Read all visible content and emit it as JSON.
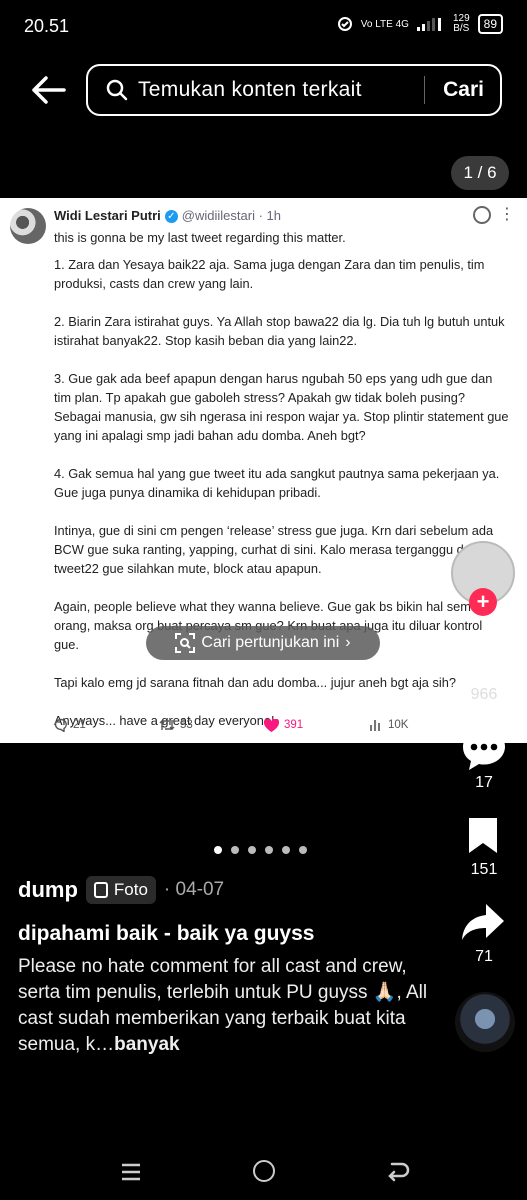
{
  "status_bar": {
    "time": "20.51",
    "network_label": "Vo LTE 4G",
    "speed_value": "129",
    "speed_unit": "B/S",
    "battery": "89"
  },
  "search": {
    "placeholder": "Temukan konten terkait",
    "button_label": "Cari"
  },
  "image_counter": "1 / 6",
  "tweet": {
    "name": "Widi Lestari Putri",
    "handle": "@widiilestari · 1h",
    "paragraphs": [
      "this is gonna be my last tweet regarding this matter.",
      "1. Zara dan Yesaya baik22 aja. Sama juga dengan Zara dan tim penulis, tim produksi, casts dan crew yang lain.",
      "2. Biarin Zara istirahat guys. Ya Allah stop bawa22 dia lg. Dia tuh lg butuh untuk istirahat banyak22. Stop kasih beban dia yang lain22.",
      "3. Gue gak ada beef apapun dengan harus ngubah 50 eps yang udh gue dan tim plan. Tp apakah gue gaboleh stress?  Apakah gw tidak boleh pusing? Sebagai manusia, gw sih ngerasa ini respon wajar ya. Stop plintir statement gue yang ini apalagi smp jadi bahan adu domba. Aneh bgt?",
      "4. Gak semua hal yang gue tweet itu ada sangkut pautnya sama pekerjaan ya. Gue juga punya dinamika di kehidupan pribadi.",
      "Intinya, gue di sini cm pengen ‘release’ stress gue juga. Krn dari sebelum ada BCW gue suka ranting, yapping, curhat di sini.  Kalo merasa terganggu dengan tweet22 gue silahkan mute, block atau apapun.",
      "Again, people believe what they wanna believe. Gue gak bs bikin hal semua orang, maksa org buat percaya sm gue? Krn buat apa juga itu diluar kontrol gue.",
      "Tapi kalo emg jd sarana fitnah dan adu domba... jujur aneh bgt aja sih?",
      "Anyways... have a great day everyone!"
    ],
    "replies": "21",
    "retweets": "53",
    "likes": "391",
    "views": "10K"
  },
  "find_show_pill": "Cari pertunjukan ini",
  "actions": {
    "like_count": "966",
    "comment_count": "17",
    "bookmark_count": "151",
    "share_count": "71"
  },
  "post": {
    "author": "dump",
    "type_tag": "Foto",
    "date": "· 04-07",
    "title": "dipahami baik - baik ya guyss",
    "description": "Please no hate comment for all cast and crew, serta tim penulis, terlebih untuk PU guyss 🙏🏻, All cast sudah memberikan yang terbaik buat kita semua, k…",
    "more_label": "banyak"
  },
  "colors": {
    "accent_red": "#fe2c55",
    "verified_blue": "#1d9bf0",
    "like_pink": "#f91880"
  }
}
